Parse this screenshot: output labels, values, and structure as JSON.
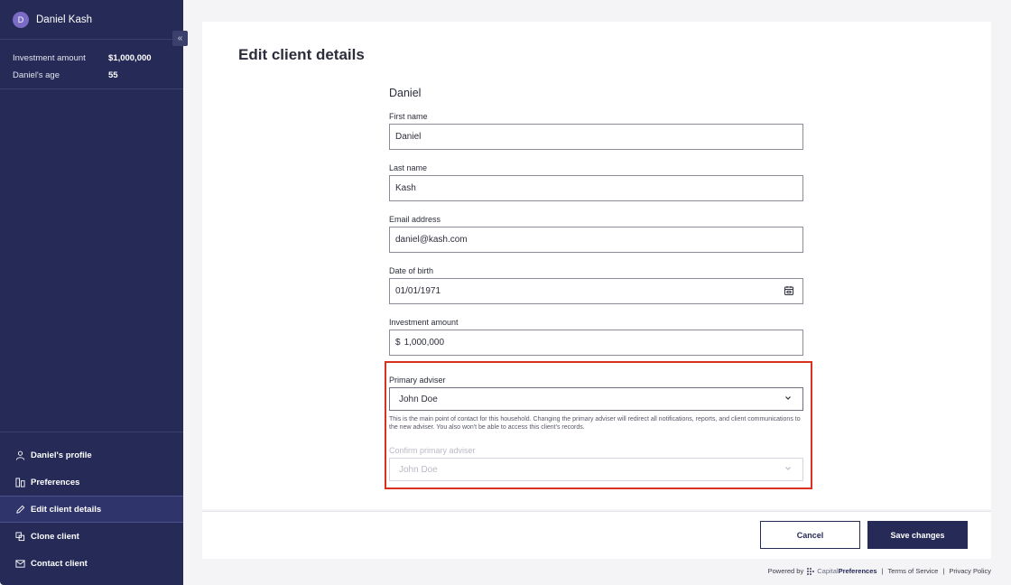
{
  "sidebar": {
    "avatar_initial": "D",
    "client_name": "Daniel Kash",
    "collapse_glyph": "«",
    "stats": [
      {
        "label": "Investment amount",
        "value": "$1,000,000"
      },
      {
        "label": "Daniel's age",
        "value": "55"
      }
    ],
    "nav": [
      {
        "label": "Daniel's profile",
        "icon": "person-icon"
      },
      {
        "label": "Preferences",
        "icon": "preferences-icon"
      },
      {
        "label": "Edit client details",
        "icon": "pencil-icon",
        "active": true
      },
      {
        "label": "Clone client",
        "icon": "clone-icon"
      },
      {
        "label": "Contact client",
        "icon": "mail-icon"
      }
    ]
  },
  "page": {
    "title": "Edit client details",
    "section_name": "Daniel"
  },
  "form": {
    "first_name": {
      "label": "First name",
      "value": "Daniel"
    },
    "last_name": {
      "label": "Last name",
      "value": "Kash"
    },
    "email": {
      "label": "Email address",
      "value": "daniel@kash.com"
    },
    "dob": {
      "label": "Date of birth",
      "value": "01/01/1971"
    },
    "investment": {
      "label": "Investment amount",
      "prefix": "$",
      "value": "1,000,000"
    },
    "primary_adviser": {
      "label": "Primary adviser",
      "value": "John Doe",
      "helper": "This is the main point of contact for this household. Changing the primary adviser will redirect all notifications, reports, and client communications to the new adviser. You also won't be able to access this client's records."
    },
    "confirm_adviser": {
      "label": "Confirm primary adviser",
      "value": "John Doe"
    }
  },
  "actions": {
    "cancel": "Cancel",
    "save": "Save changes"
  },
  "footer": {
    "powered_by": "Powered by",
    "brand_part1": "Capital",
    "brand_part2": "Preferences",
    "terms": "Terms of Service",
    "privacy": "Privacy Policy",
    "separator": "|"
  },
  "colors": {
    "sidebar_bg": "#252a57",
    "accent": "#252a57",
    "highlight": "#d9311f"
  }
}
